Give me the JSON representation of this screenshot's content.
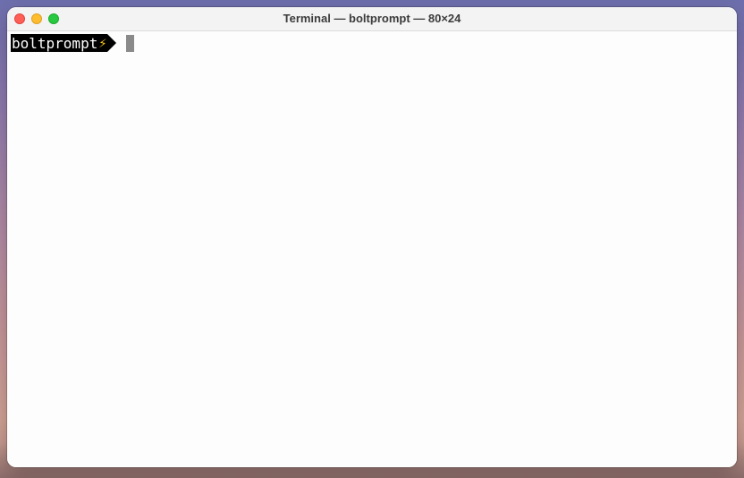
{
  "window": {
    "title": "Terminal — boltprompt — 80×24"
  },
  "terminal": {
    "prompt": {
      "text": "boltprompt",
      "icon": "⚡",
      "icon_name": "lightning-bolt-icon",
      "segment_color": "#000000",
      "text_color": "#ffffff",
      "icon_color": "#f5c518"
    },
    "cursor_color": "#8a8a8a"
  },
  "colors": {
    "close": "#ff5f57",
    "minimize": "#febc2e",
    "maximize": "#28c840"
  }
}
